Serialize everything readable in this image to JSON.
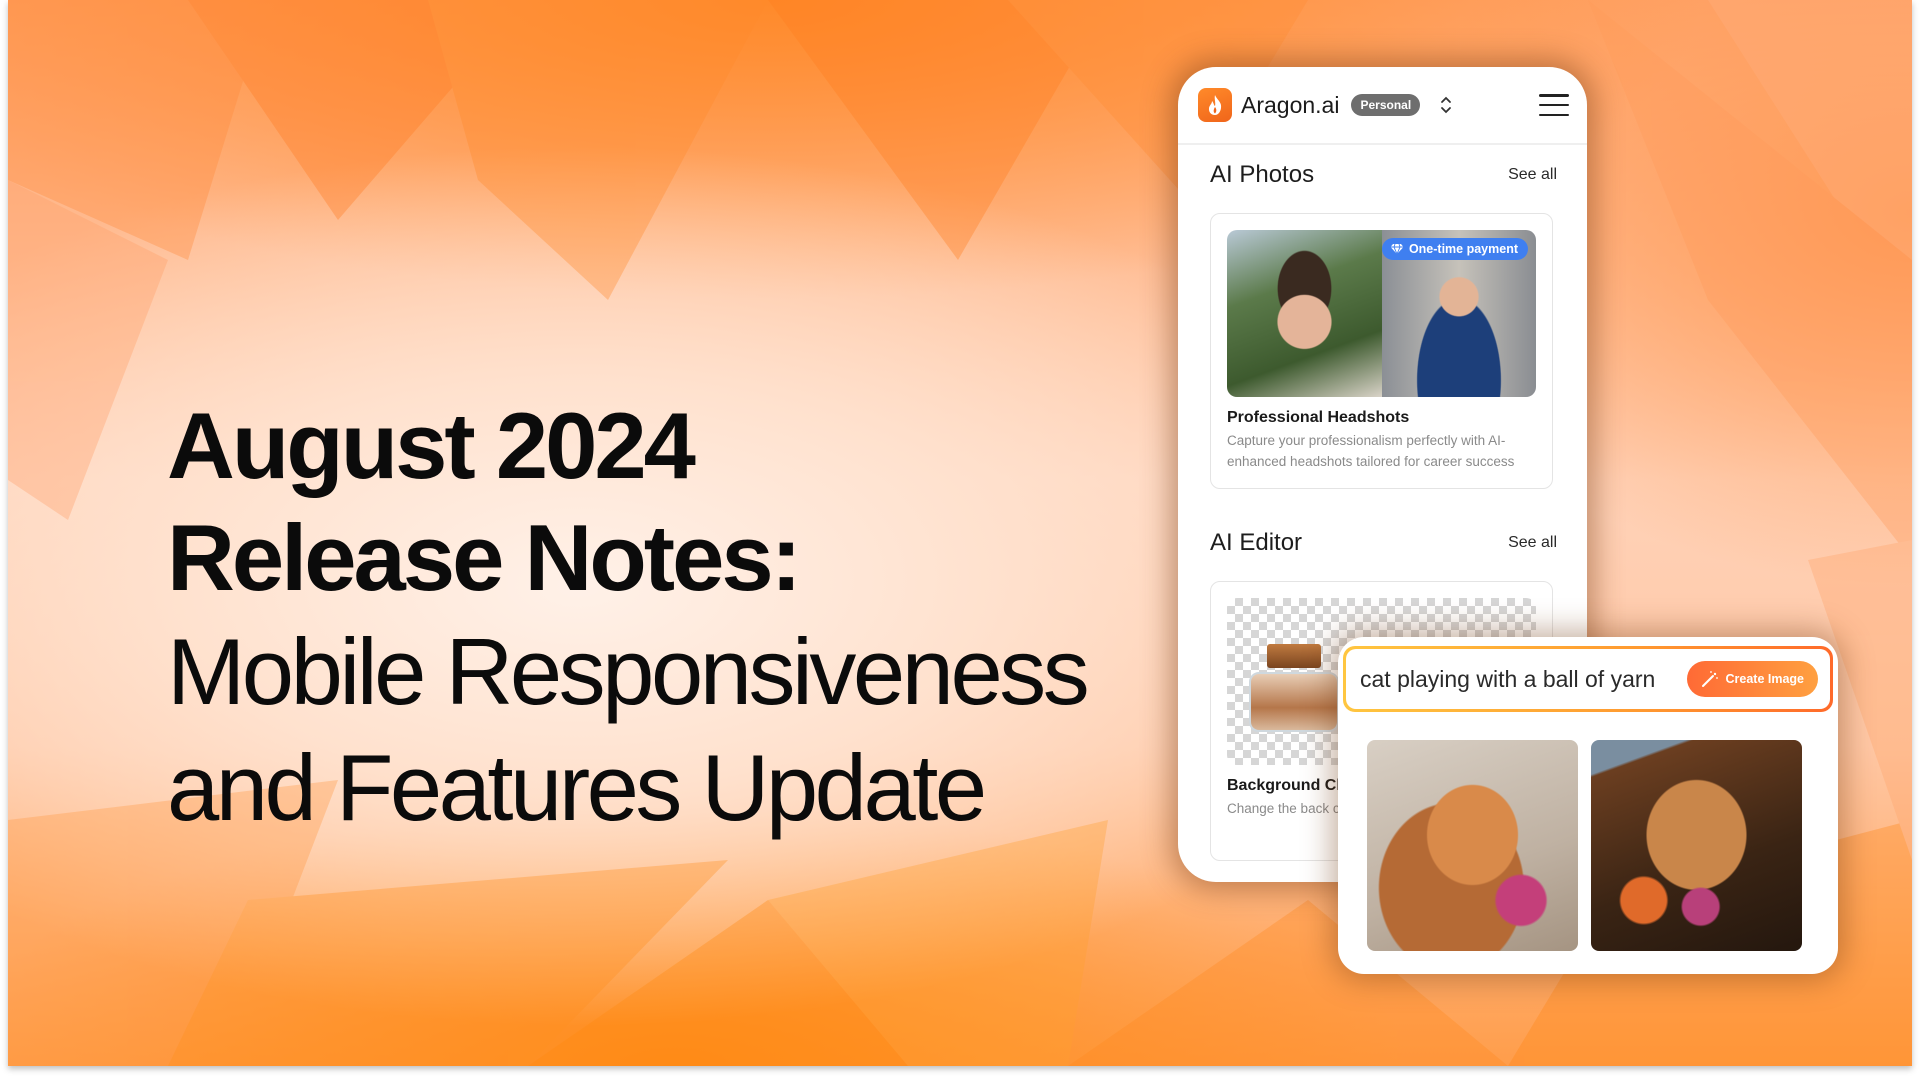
{
  "headline": {
    "line1": "August 2024",
    "line2": "Release Notes:",
    "line3": "Mobile Responsiveness",
    "line4": "and Features Update"
  },
  "phone": {
    "brand": "Aragon.ai",
    "workspace_badge": "Personal",
    "icons": {
      "logo": "flame-icon",
      "switcher": "chevron-up-down-icon",
      "menu": "hamburger-menu-icon"
    },
    "sections": [
      {
        "title": "AI Photos",
        "see_all": "See all",
        "card": {
          "badge": "One-time payment",
          "badge_icon": "diamond-icon",
          "title": "Professional Headshots",
          "description": "Capture your professionalism perfectly with AI-enhanced headshots tailored for career success"
        }
      },
      {
        "title": "AI Editor",
        "see_all": "See all",
        "card": {
          "title": "Background Ch",
          "description": "Change the back create the perfec"
        }
      }
    ]
  },
  "generator": {
    "prompt_value": "cat playing with a ball of yarn",
    "button_label": "Create Image",
    "button_icon": "magic-wand-icon",
    "results": [
      "cat-with-yarn-image-1",
      "cat-with-yarn-image-2"
    ]
  },
  "colors": {
    "brand_orange": "#f47320",
    "badge_blue": "#3f7ff0",
    "badge_gray": "#6e6e6e",
    "button_gradient_start": "#ff6a35",
    "button_gradient_end": "#ffa040"
  }
}
